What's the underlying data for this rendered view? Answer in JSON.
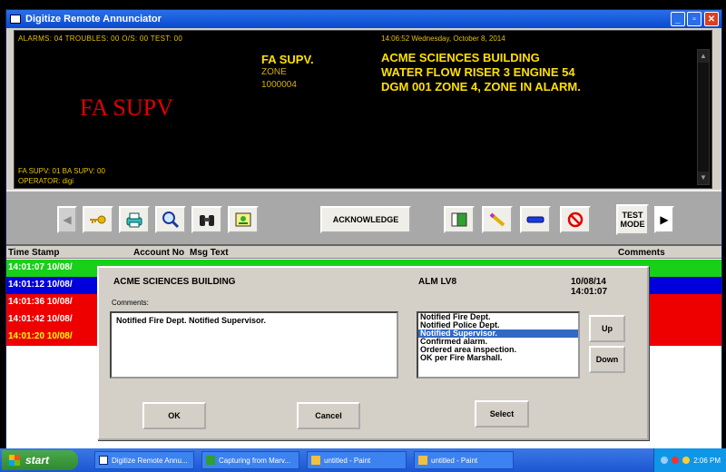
{
  "window": {
    "title": "Digitize Remote Annunciator"
  },
  "display": {
    "counts": "ALARMS: 04   TROUBLES: 00   O/S: 00   TEST: 00",
    "big_status": "FA SUPV",
    "alarm_type": "FA SUPV.",
    "alarm_zone_label": "ZONE",
    "alarm_zone_number": "1000004",
    "datetime": "14:06:52 Wednesday, October 8, 2014",
    "message_lines": [
      "ACME SCIENCES BUILDING",
      "WATER FLOW RISER 3 ENGINE 54",
      "DGM 001 ZONE 4, ZONE IN ALARM."
    ],
    "supv_counts": "FA SUPV: 01   BA SUPV: 00",
    "operator": "OPERATOR: digi"
  },
  "toolbar": {
    "acknowledge_label": "ACKNOWLEDGE",
    "test_mode_label": "TEST MODE",
    "icons": [
      "key-icon",
      "printer-icon",
      "magnifier-icon",
      "binoculars-icon",
      "map-icon",
      "book-icon",
      "pencil-icon",
      "minus-icon",
      "no-symbol-icon"
    ]
  },
  "table": {
    "headers": {
      "time_stamp": "Time Stamp",
      "account_no": "Account No",
      "msg_text": "Msg Text",
      "comments": "Comments"
    },
    "rows": [
      {
        "time": "14:01:07 10/08/",
        "bg": "#19d019",
        "fg": "#ffffff"
      },
      {
        "time": "14:01:12 10/08/",
        "bg": "#0000dd",
        "fg": "#ffffff"
      },
      {
        "time": "14:01:36 10/08/",
        "bg": "#ee0000",
        "fg": "#ffffff"
      },
      {
        "time": "14:01:42 10/08/",
        "bg": "#ee0000",
        "fg": "#ffffff"
      },
      {
        "time": "14:01:20 10/08/",
        "bg": "#ee0000",
        "fg": "#ffff00"
      }
    ]
  },
  "dialog": {
    "building": "ACME SCIENCES BUILDING",
    "level": "ALM LV8",
    "date": "10/08/14",
    "time": "14:01:07",
    "comments_label": "Comments:",
    "comment_text": "Notified Fire Dept.  Notified Supervisor.",
    "presets": [
      "Notified Fire Dept.",
      "Notified Police Dept.",
      "Notified Supervisor.",
      "Confirmed alarm.",
      "Ordered area inspection.",
      "OK per Fire Marshall."
    ],
    "selected_index": 2,
    "up_label": "Up",
    "down_label": "Down",
    "ok_label": "OK",
    "cancel_label": "Cancel",
    "select_label": "Select"
  },
  "taskbar": {
    "start_label": "start",
    "tasks": [
      "Digitize Remote Annu...",
      "Capturing from Marv...",
      "untitled - Paint",
      "untitled - Paint"
    ],
    "clock": "2:06 PM"
  }
}
